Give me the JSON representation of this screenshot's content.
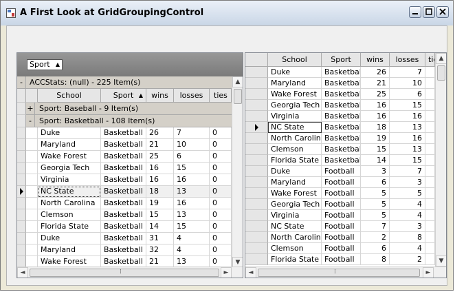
{
  "window": {
    "title": "A First Look at GridGroupingControl"
  },
  "left": {
    "group_chip": "Sport",
    "table_caption": "ACCStats: (null) - 225 Item(s)",
    "expander_minus": "-",
    "expander_plus": "+",
    "columns": [
      "School",
      "Sport",
      "wins",
      "losses",
      "ties"
    ],
    "group_baseball": "Sport: Baseball - 9 Item(s)",
    "group_basketball": "Sport: Basketball - 108 Item(s)",
    "rows": [
      [
        "Duke",
        "Basketball",
        "26",
        "7",
        "0"
      ],
      [
        "Maryland",
        "Basketball",
        "21",
        "10",
        "0"
      ],
      [
        "Wake Forest",
        "Basketball",
        "25",
        "6",
        "0"
      ],
      [
        "Georgia Tech",
        "Basketball",
        "16",
        "15",
        "0"
      ],
      [
        "Virginia",
        "Basketball",
        "16",
        "16",
        "0"
      ],
      [
        "NC State",
        "Basketball",
        "18",
        "13",
        "0"
      ],
      [
        "North Carolina",
        "Basketball",
        "19",
        "16",
        "0"
      ],
      [
        "Clemson",
        "Basketball",
        "15",
        "13",
        "0"
      ],
      [
        "Florida State",
        "Basketball",
        "14",
        "15",
        "0"
      ],
      [
        "Duke",
        "Basketball",
        "31",
        "4",
        "0"
      ],
      [
        "Maryland",
        "Basketball",
        "32",
        "4",
        "0"
      ],
      [
        "Wake Forest",
        "Basketball",
        "21",
        "13",
        "0"
      ]
    ]
  },
  "right": {
    "columns": [
      "School",
      "Sport",
      "wins",
      "losses",
      "ties"
    ],
    "rows": [
      [
        "Duke",
        "Basketball",
        "26",
        "7"
      ],
      [
        "Maryland",
        "Basketball",
        "21",
        "10"
      ],
      [
        "Wake Forest",
        "Basketball",
        "25",
        "6"
      ],
      [
        "Georgia Tech",
        "Basketball",
        "16",
        "15"
      ],
      [
        "Virginia",
        "Basketball",
        "16",
        "16"
      ],
      [
        "NC State",
        "Basketball",
        "18",
        "13"
      ],
      [
        "North Carolina",
        "Basketball",
        "19",
        "16"
      ],
      [
        "Clemson",
        "Basketball",
        "15",
        "13"
      ],
      [
        "Florida State",
        "Basketball",
        "14",
        "15"
      ],
      [
        "Duke",
        "Football",
        "3",
        "7"
      ],
      [
        "Maryland",
        "Football",
        "6",
        "3"
      ],
      [
        "Wake Forest",
        "Football",
        "5",
        "5"
      ],
      [
        "Georgia Tech",
        "Football",
        "5",
        "4"
      ],
      [
        "Virginia",
        "Football",
        "5",
        "4"
      ],
      [
        "NC State",
        "Football",
        "7",
        "3"
      ],
      [
        "North Carolina",
        "Football",
        "2",
        "8"
      ],
      [
        "Clemson",
        "Football",
        "6",
        "4"
      ],
      [
        "Florida State",
        "Football",
        "8",
        "2"
      ]
    ]
  },
  "icons": {
    "scroll_up": "▲",
    "scroll_down": "▼",
    "scroll_left": "◄",
    "scroll_right": "►",
    "thumb_grip": "⁞"
  }
}
